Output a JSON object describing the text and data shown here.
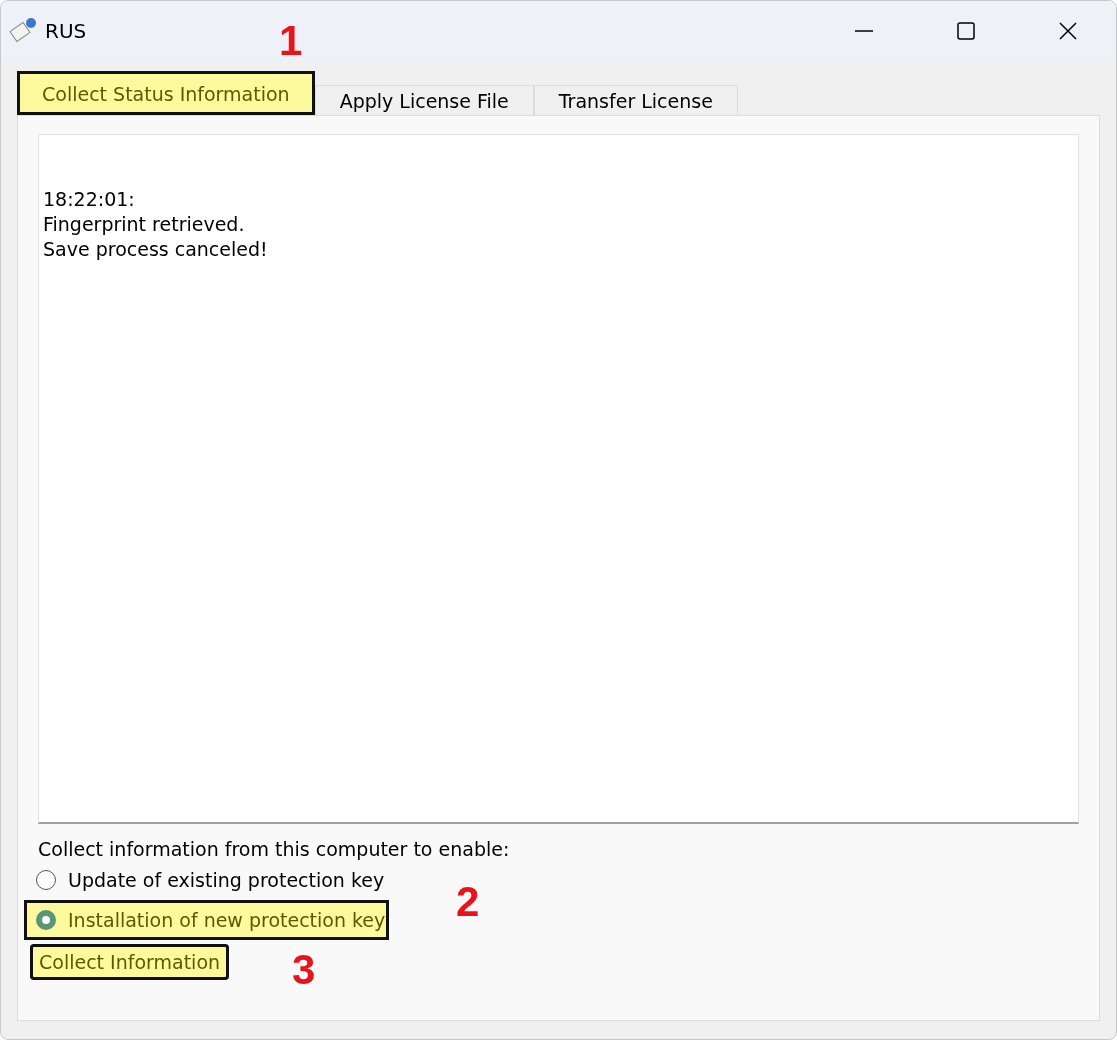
{
  "window": {
    "title": "RUS"
  },
  "tabs": [
    {
      "label": "Collect Status Information",
      "selected": true,
      "highlighted": true,
      "callout": "1"
    },
    {
      "label": "Apply License File",
      "selected": false,
      "highlighted": false
    },
    {
      "label": "Transfer License",
      "selected": false,
      "highlighted": false
    }
  ],
  "log": {
    "lines": [
      "18:22:01:",
      "Fingerprint retrieved.",
      "Save process canceled!"
    ]
  },
  "prompt": "Collect information from this computer to enable:",
  "options": [
    {
      "label": "Update of existing protection key",
      "selected": false,
      "highlighted": false
    },
    {
      "label": "Installation of new protection key",
      "selected": true,
      "highlighted": true,
      "callout": "2"
    }
  ],
  "button": {
    "label": "Collect Information",
    "highlighted": true,
    "callout": "3"
  }
}
